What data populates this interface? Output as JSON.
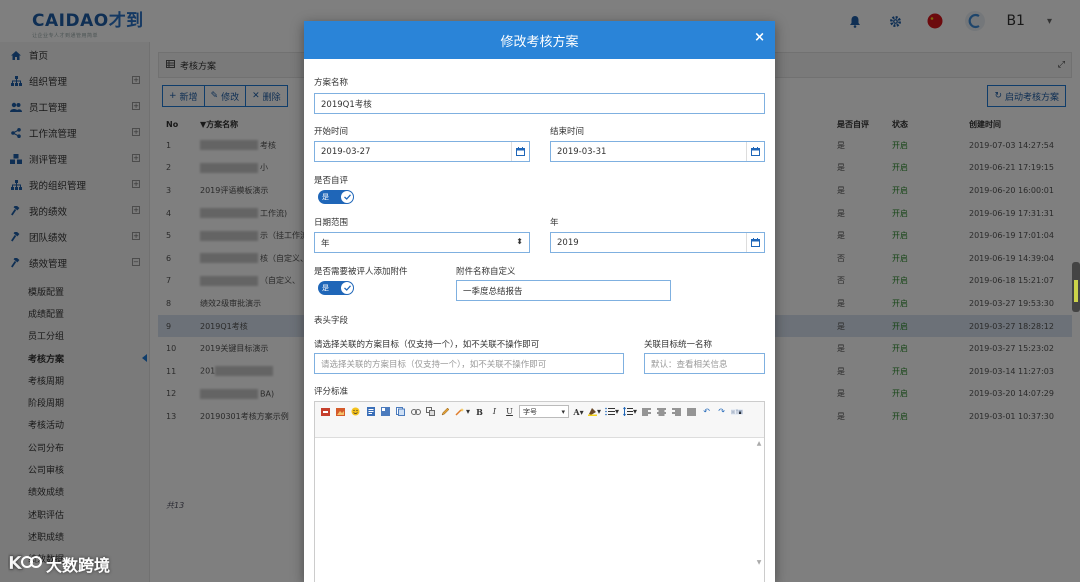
{
  "header": {
    "logo_text": "CAIDAO",
    "logo_cn": "才到",
    "logo_sub": "让企业专人才到通管用简单",
    "user": "B1",
    "icons": [
      "bell-icon",
      "gear-icon",
      "flag-icon",
      "refresh-icon"
    ]
  },
  "sidebar": {
    "items": [
      {
        "label": "首页"
      },
      {
        "label": "组织管理"
      },
      {
        "label": "员工管理"
      },
      {
        "label": "工作流管理"
      },
      {
        "label": "测评管理"
      },
      {
        "label": "我的组织管理"
      },
      {
        "label": "我的绩效"
      },
      {
        "label": "团队绩效"
      },
      {
        "label": "绩效管理"
      }
    ],
    "sub_items": [
      {
        "label": "模版配置"
      },
      {
        "label": "成绩配置"
      },
      {
        "label": "员工分组"
      },
      {
        "label": "考核方案"
      },
      {
        "label": "考核周期"
      },
      {
        "label": "阶段周期"
      },
      {
        "label": "考核活动"
      },
      {
        "label": "公司分布"
      },
      {
        "label": "公司审核"
      },
      {
        "label": "绩效成绩"
      },
      {
        "label": "述职评估"
      },
      {
        "label": "述职成绩"
      },
      {
        "label": "绩效数据"
      }
    ]
  },
  "panel": {
    "title": "考核方案",
    "buttons": {
      "add": "新增",
      "edit": "修改",
      "delete": "删除"
    },
    "start_button": "启动考核方案",
    "columns": {
      "no": "No",
      "name": "方案名称",
      "self": "是否自评",
      "status": "状态",
      "created": "创建时间"
    },
    "rows": [
      {
        "no": "1",
        "name": "考核",
        "self": "是",
        "status": "开启",
        "created": "2019-07-03 14:27:54"
      },
      {
        "no": "2",
        "name": "小",
        "self": "是",
        "status": "开启",
        "created": "2019-06-21 17:19:15"
      },
      {
        "no": "3",
        "name": "2019评语模板演示",
        "self": "是",
        "status": "开启",
        "created": "2019-06-20 16:00:01"
      },
      {
        "no": "4",
        "name": "工作流)",
        "self": "是",
        "status": "开启",
        "created": "2019-06-19 17:31:31"
      },
      {
        "no": "5",
        "name": "示（挂工作流）",
        "self": "是",
        "status": "开启",
        "created": "2019-06-19 17:01:04"
      },
      {
        "no": "6",
        "name": "核（自定义、",
        "self": "否",
        "status": "开启",
        "created": "2019-06-19 14:39:04"
      },
      {
        "no": "7",
        "name": "（自定义、",
        "self": "否",
        "status": "开启",
        "created": "2019-06-18 15:21:07"
      },
      {
        "no": "8",
        "name": "绩效2级审批演示",
        "self": "是",
        "status": "开启",
        "created": "2019-03-27 19:53:30"
      },
      {
        "no": "9",
        "name": "2019Q1考核",
        "self": "是",
        "status": "开启",
        "created": "2019-03-27 18:28:12"
      },
      {
        "no": "10",
        "name": "2019关键目标演示",
        "self": "是",
        "status": "开启",
        "created": "2019-03-27 15:23:02"
      },
      {
        "no": "11",
        "name": "201",
        "self": "是",
        "status": "开启",
        "created": "2019-03-14 11:27:03"
      },
      {
        "no": "12",
        "name": "BA)",
        "self": "是",
        "status": "开启",
        "created": "2019-03-20 14:07:29"
      },
      {
        "no": "13",
        "name": "20190301考核方案示例",
        "self": "是",
        "status": "开启",
        "created": "2019-03-01 10:37:30"
      }
    ],
    "total": "共13"
  },
  "modal": {
    "title": "修改考核方案",
    "close": "×",
    "name_label": "方案名称",
    "name_value": "2019Q1考核",
    "start_label": "开始时间",
    "start_value": "2019-03-27",
    "end_label": "结束时间",
    "end_value": "2019-03-31",
    "self_label": "是否自评",
    "toggle_on": "是",
    "range_label": "日期范围",
    "range_value": "年",
    "year_label": "年",
    "year_value": "2019",
    "attach_label": "是否需要被评人添加附件",
    "attach_name_label": "附件名称自定义",
    "attach_name_value": "一季度总结报告",
    "header_fields_label": "表头字段",
    "goal_label": "请选择关联的方案目标（仅支持一个），如不关联不操作即可",
    "goal_placeholder": "请选择关联的方案目标（仅支持一个），如不关联不操作即可",
    "goal_name_label": "关联目标统一名称",
    "goal_name_placeholder": "默认：查看相关信息",
    "criteria_label": "评分标准",
    "font_size_label": "字号"
  },
  "watermark": "大数跨境",
  "colors": {
    "brand": "#2a84d8",
    "accent": "#1f66b8",
    "status_green": "#2b8a2b"
  }
}
